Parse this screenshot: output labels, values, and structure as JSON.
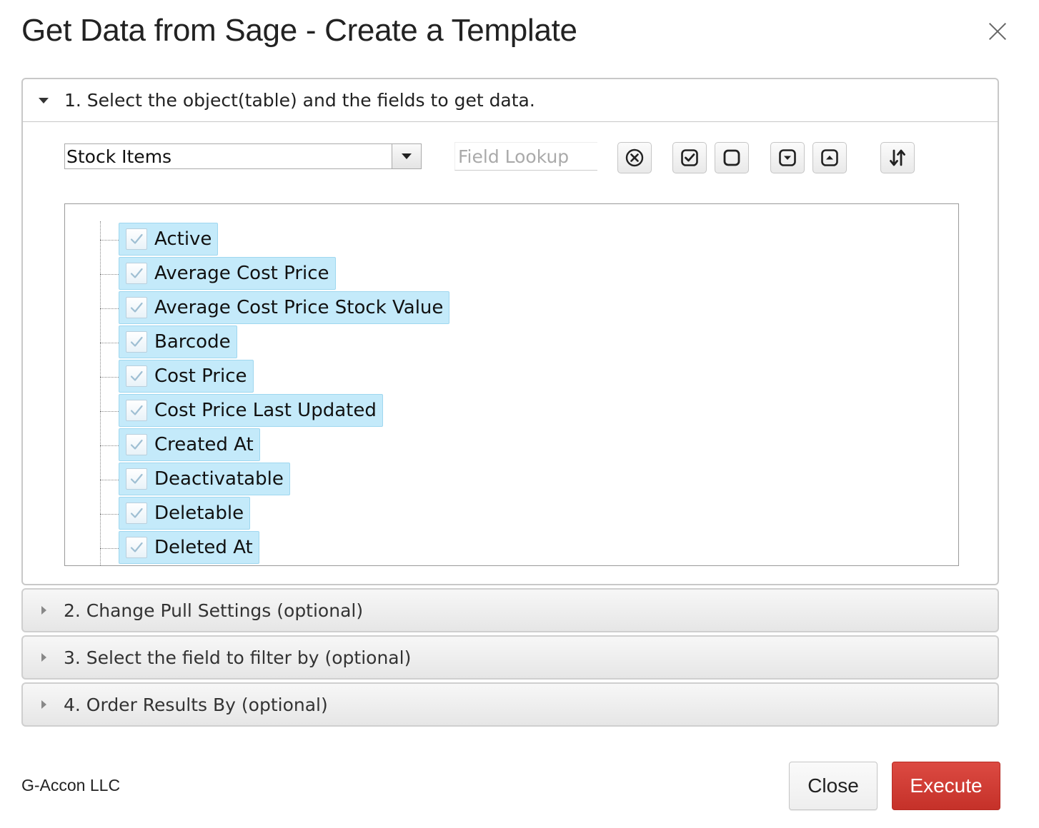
{
  "dialog": {
    "title": "Get Data from Sage - Create a Template",
    "close_icon": "close-icon"
  },
  "section1": {
    "header": "1. Select the object(table) and the fields to get data.",
    "object_select": {
      "value": "Stock Items"
    },
    "field_lookup": {
      "placeholder": "Field Lookup",
      "value": ""
    },
    "toolbar_icons": [
      "clear-circle-x-icon",
      "check-all-icon",
      "uncheck-all-icon",
      "expand-all-icon",
      "collapse-all-icon",
      "sort-icon"
    ],
    "fields": [
      {
        "label": "Active",
        "checked": true
      },
      {
        "label": "Average Cost Price",
        "checked": true
      },
      {
        "label": "Average Cost Price Stock Value",
        "checked": true
      },
      {
        "label": "Barcode",
        "checked": true
      },
      {
        "label": "Cost Price",
        "checked": true
      },
      {
        "label": "Cost Price Last Updated",
        "checked": true
      },
      {
        "label": "Created At",
        "checked": true
      },
      {
        "label": "Deactivatable",
        "checked": true
      },
      {
        "label": "Deletable",
        "checked": true
      },
      {
        "label": "Deleted At",
        "checked": true
      }
    ]
  },
  "section2": {
    "header": "2. Change Pull Settings (optional)"
  },
  "section3": {
    "header": "3. Select the field to filter by (optional)"
  },
  "section4": {
    "header": "4. Order Results By (optional)"
  },
  "footer": {
    "brand": "G-Accon LLC",
    "close_label": "Close",
    "execute_label": "Execute"
  },
  "colors": {
    "selection_bg": "#c4eafa",
    "execute_bg": "#cf3b33"
  }
}
